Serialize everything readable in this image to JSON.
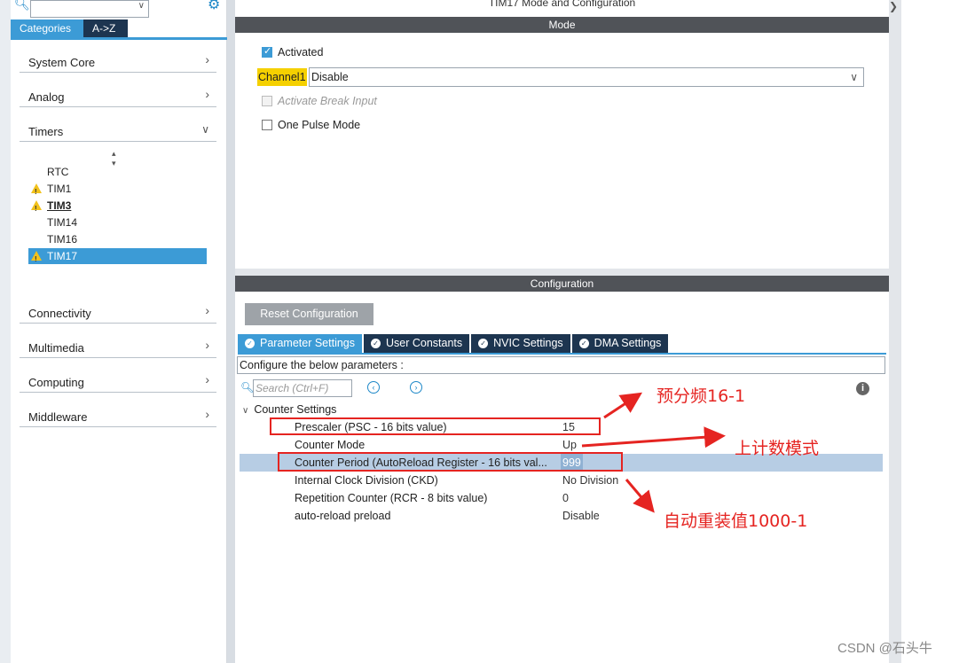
{
  "sidebar": {
    "tabs": [
      "Categories",
      "A->Z"
    ],
    "categories_top": [
      "System Core",
      "Analog",
      "Timers"
    ],
    "timers": [
      "RTC",
      "TIM1",
      "TIM3",
      "TIM14",
      "TIM16",
      "TIM17"
    ],
    "categories_bottom": [
      "Connectivity",
      "Multimedia",
      "Computing",
      "Middleware"
    ]
  },
  "main": {
    "title": "TIM17 Mode and Configuration",
    "mode_header": "Mode",
    "activated_label": "Activated",
    "channel_label": "Channel1",
    "channel_value": "Disable",
    "break_input_label": "Activate Break Input",
    "one_pulse_label": "One Pulse Mode",
    "config_header": "Configuration",
    "reset_button": "Reset Configuration",
    "tabs": [
      "Parameter Settings",
      "User Constants",
      "NVIC Settings",
      "DMA Settings"
    ],
    "config_desc": "Configure the below parameters :",
    "search_placeholder": "Search (Ctrl+F)",
    "group_label": "Counter Settings",
    "params": [
      {
        "name": "Prescaler (PSC - 16 bits value)",
        "value": "15"
      },
      {
        "name": "Counter Mode",
        "value": "Up"
      },
      {
        "name": "Counter Period (AutoReload Register - 16 bits val...",
        "value": "999"
      },
      {
        "name": "Internal Clock Division (CKD)",
        "value": "No Division"
      },
      {
        "name": "Repetition Counter (RCR - 8 bits value)",
        "value": "0"
      },
      {
        "name": "auto-reload preload",
        "value": "Disable"
      }
    ]
  },
  "annotations": {
    "prescaler_note": "预分频16-1",
    "count_mode_note": "上计数模式",
    "period_note": "自动重装值1000-1",
    "color": "#e52421"
  },
  "watermark": "CSDN @石头牛"
}
